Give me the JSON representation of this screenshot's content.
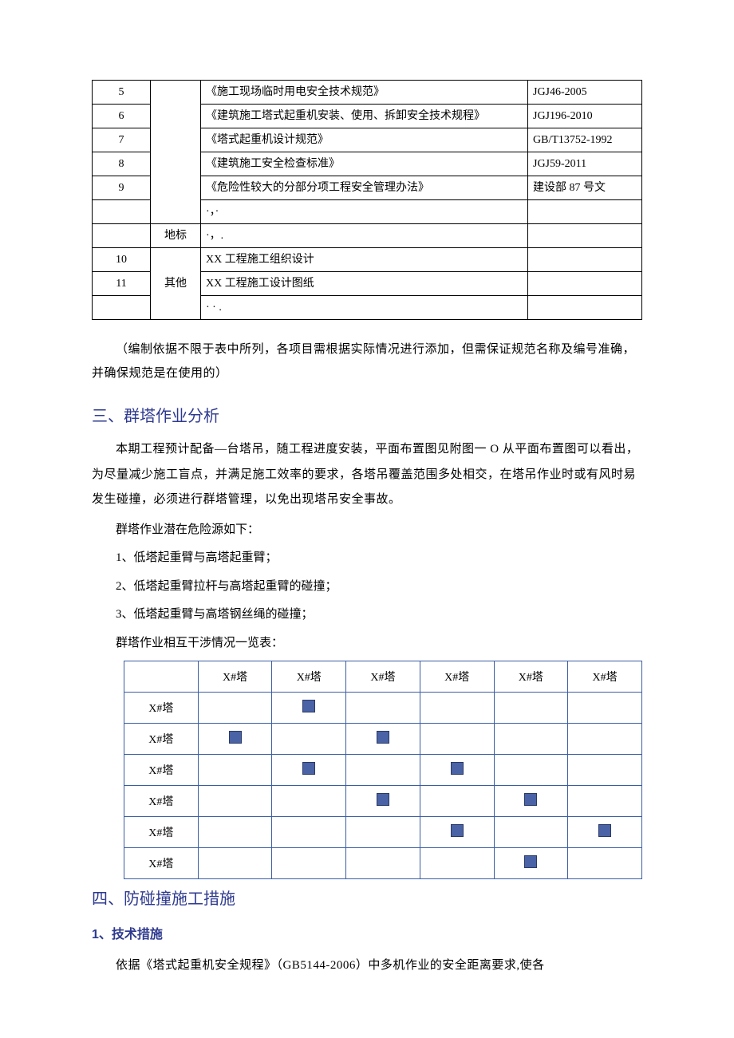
{
  "table1": {
    "rows": [
      {
        "num": "5",
        "cat": "",
        "name": "《施工现场临时用电安全技术规范》",
        "code": "JGJ46-2005"
      },
      {
        "num": "6",
        "cat": "",
        "name": "《建筑施工塔式起重机安装、使用、拆卸安全技术规程》",
        "code": "JGJ196-2010"
      },
      {
        "num": "7",
        "cat": "",
        "name": "《塔式起重机设计规范》",
        "code": "GB/T13752-1992"
      },
      {
        "num": "8",
        "cat": "",
        "name": "《建筑施工安全检查标准》",
        "code": "JGJ59-2011"
      },
      {
        "num": "9",
        "cat": "",
        "name": "《危险性较大的分部分项工程安全管理办法》",
        "code": "建设部 87 号文"
      },
      {
        "num": "",
        "cat": "",
        "name": "·，·",
        "code": ""
      },
      {
        "num": "",
        "cat": "地标",
        "name": "·，.",
        "code": ""
      },
      {
        "num": "10",
        "cat": "其他",
        "name": "XX 工程施工组织设计",
        "code": ""
      },
      {
        "num": "11",
        "cat": "",
        "name": "XX 工程施工设计图纸",
        "code": ""
      },
      {
        "num": "",
        "cat": "",
        "name": "· · .",
        "code": ""
      }
    ],
    "cat_other_label": "其他"
  },
  "note": "（编制依据不限于表中所列，各项目需根据实际情况进行添加，但需保证规范名称及编号准确，并确保规范是在使用的）",
  "h_sec3": "三、群塔作业分析",
  "para1": "本期工程预计配备—台塔吊，随工程进度安装，平面布置图见附图一 O 从平面布置图可以看出，为尽量减少施工盲点，并满足施工效率的要求，各塔吊覆盖范围多处相交，在塔吊作业时或有风时易发生碰撞，必须进行群塔管理，以免出现塔吊安全事故。",
  "line_risk_intro": "群塔作业潜在危险源如下：",
  "risk1": "1、低塔起重臂与高塔起重臂；",
  "risk2": "2、低塔起重臂拉杆与高塔起重臂的碰撞；",
  "risk3": "3、低塔起重臂与高塔钢丝绳的碰撞；",
  "matrix_title": "群塔作业相互干涉情况一览表：",
  "chart_data": {
    "type": "table",
    "row_labels": [
      "X#塔",
      "X#塔",
      "X#塔",
      "X#塔",
      "X#塔",
      "X#塔"
    ],
    "col_labels": [
      "X#塔",
      "X#塔",
      "X#塔",
      "X#塔",
      "X#塔",
      "X#塔"
    ],
    "values": [
      [
        0,
        1,
        0,
        0,
        0,
        0
      ],
      [
        1,
        0,
        1,
        0,
        0,
        0
      ],
      [
        0,
        1,
        0,
        1,
        0,
        0
      ],
      [
        0,
        0,
        1,
        0,
        1,
        0
      ],
      [
        0,
        0,
        0,
        1,
        0,
        1
      ],
      [
        0,
        0,
        0,
        0,
        1,
        0
      ]
    ]
  },
  "h_sec4": "四、防碰撞施工措施",
  "h_sec4_1": "1、技术措施",
  "para2": "依据《塔式起重机安全规程》（GB5144-2006）中多机作业的安全距离要求,使各"
}
